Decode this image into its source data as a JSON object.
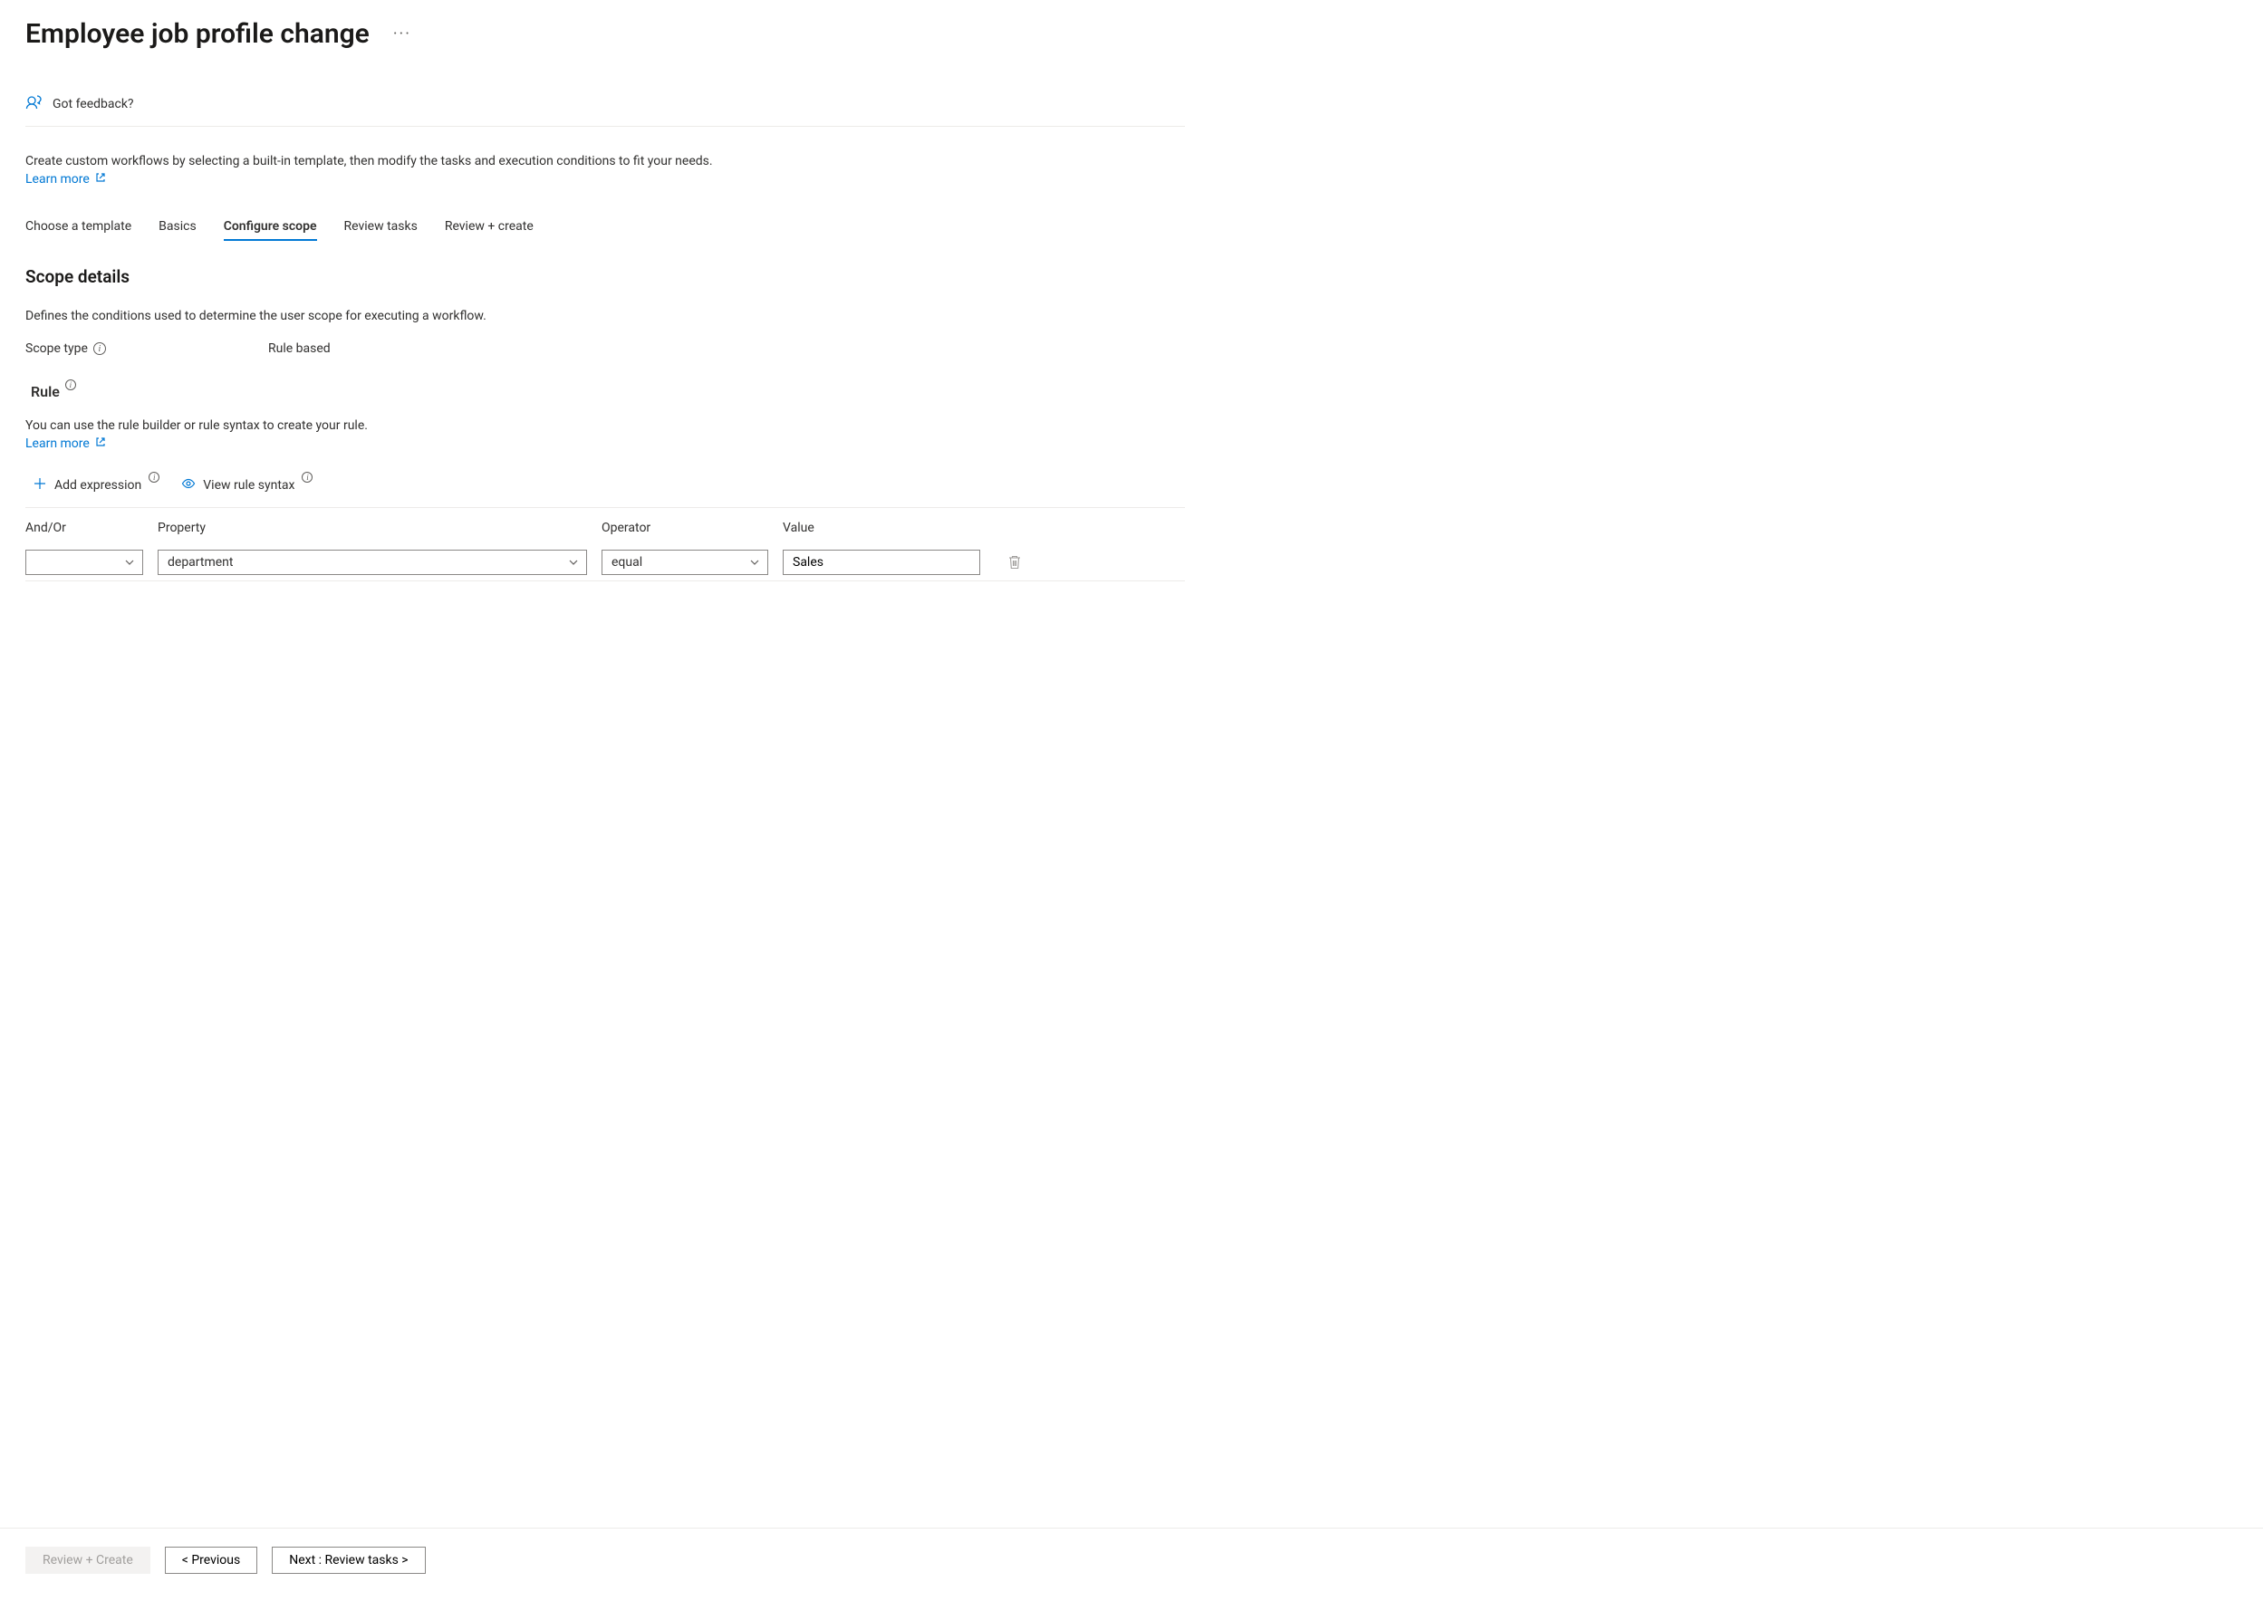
{
  "header": {
    "title": "Employee job profile change",
    "feedback_label": "Got feedback?"
  },
  "intro": {
    "text": "Create custom workflows by selecting a built-in template, then modify the tasks and execution conditions to fit your needs.",
    "learn_more_label": "Learn more"
  },
  "tabs": [
    {
      "label": "Choose a template",
      "active": false
    },
    {
      "label": "Basics",
      "active": false
    },
    {
      "label": "Configure scope",
      "active": true
    },
    {
      "label": "Review tasks",
      "active": false
    },
    {
      "label": "Review + create",
      "active": false
    }
  ],
  "scope": {
    "section_title": "Scope details",
    "section_desc": "Defines the conditions used to determine the user scope for executing a workflow.",
    "type_label": "Scope type",
    "type_value": "Rule based"
  },
  "rule": {
    "title": "Rule",
    "desc": "You can use the rule builder or rule syntax to create your rule.",
    "learn_more_label": "Learn more",
    "add_expression_label": "Add expression",
    "view_rule_syntax_label": "View rule syntax"
  },
  "rule_table": {
    "headers": {
      "and_or": "And/Or",
      "property": "Property",
      "operator": "Operator",
      "value": "Value"
    },
    "rows": [
      {
        "and_or": "",
        "property": "department",
        "operator": "equal",
        "value": "Sales"
      }
    ]
  },
  "footer": {
    "review_create_label": "Review + Create",
    "previous_label": "< Previous",
    "next_label": "Next : Review tasks >"
  }
}
